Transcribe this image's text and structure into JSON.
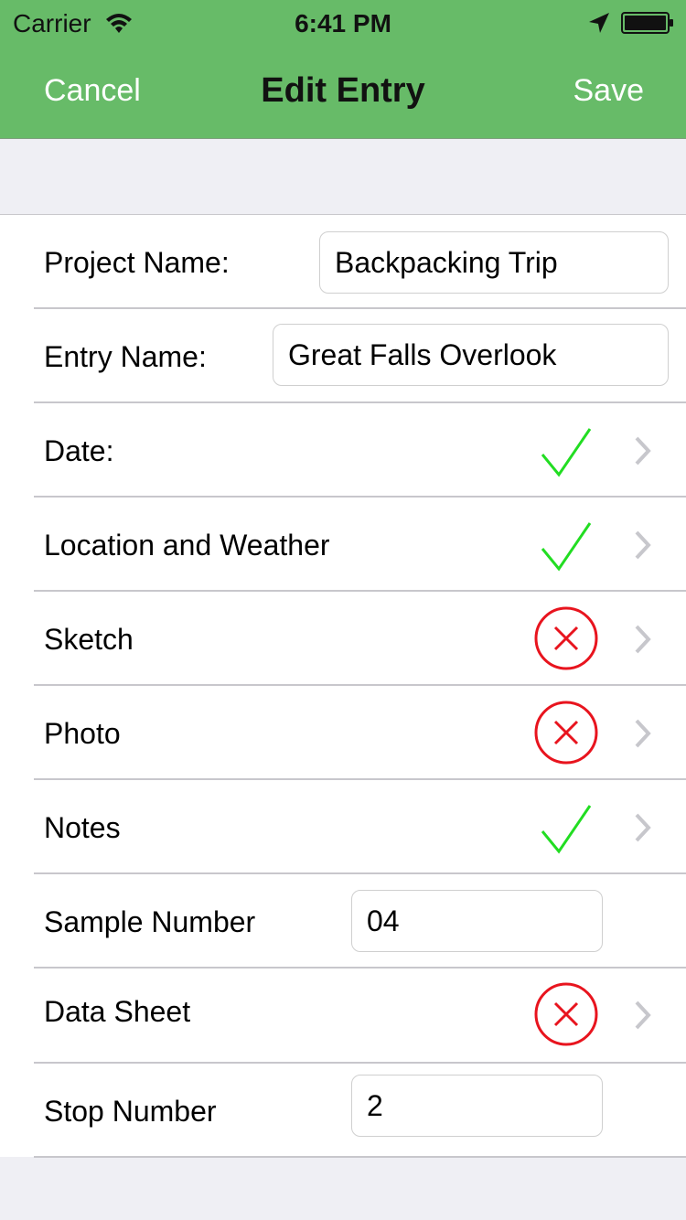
{
  "status_bar": {
    "carrier": "Carrier",
    "time": "6:41 PM"
  },
  "nav": {
    "cancel_label": "Cancel",
    "title": "Edit Entry",
    "save_label": "Save",
    "bar_color": "#67bb68"
  },
  "form": {
    "project_name": {
      "label": "Project Name:",
      "value": "Backpacking Trip"
    },
    "entry_name": {
      "label": "Entry Name:",
      "value": "Great Falls Overlook"
    },
    "date": {
      "label": "Date:",
      "status": "complete",
      "icon": "checkmark-icon"
    },
    "location_weather": {
      "label": "Location and Weather",
      "status": "complete",
      "icon": "checkmark-icon"
    },
    "sketch": {
      "label": "Sketch",
      "status": "missing",
      "icon": "x-circle-icon"
    },
    "photo": {
      "label": "Photo",
      "status": "missing",
      "icon": "x-circle-icon"
    },
    "notes": {
      "label": "Notes",
      "status": "complete",
      "icon": "checkmark-icon"
    },
    "sample_number": {
      "label": "Sample Number",
      "value": "04"
    },
    "data_sheet": {
      "label": "Data Sheet",
      "status": "missing",
      "icon": "x-circle-icon"
    },
    "stop_number": {
      "label": "Stop Number",
      "value": "2"
    }
  },
  "colors": {
    "complete": "#22dd22",
    "missing": "#e8141e",
    "chevron": "#c7c7cc"
  }
}
